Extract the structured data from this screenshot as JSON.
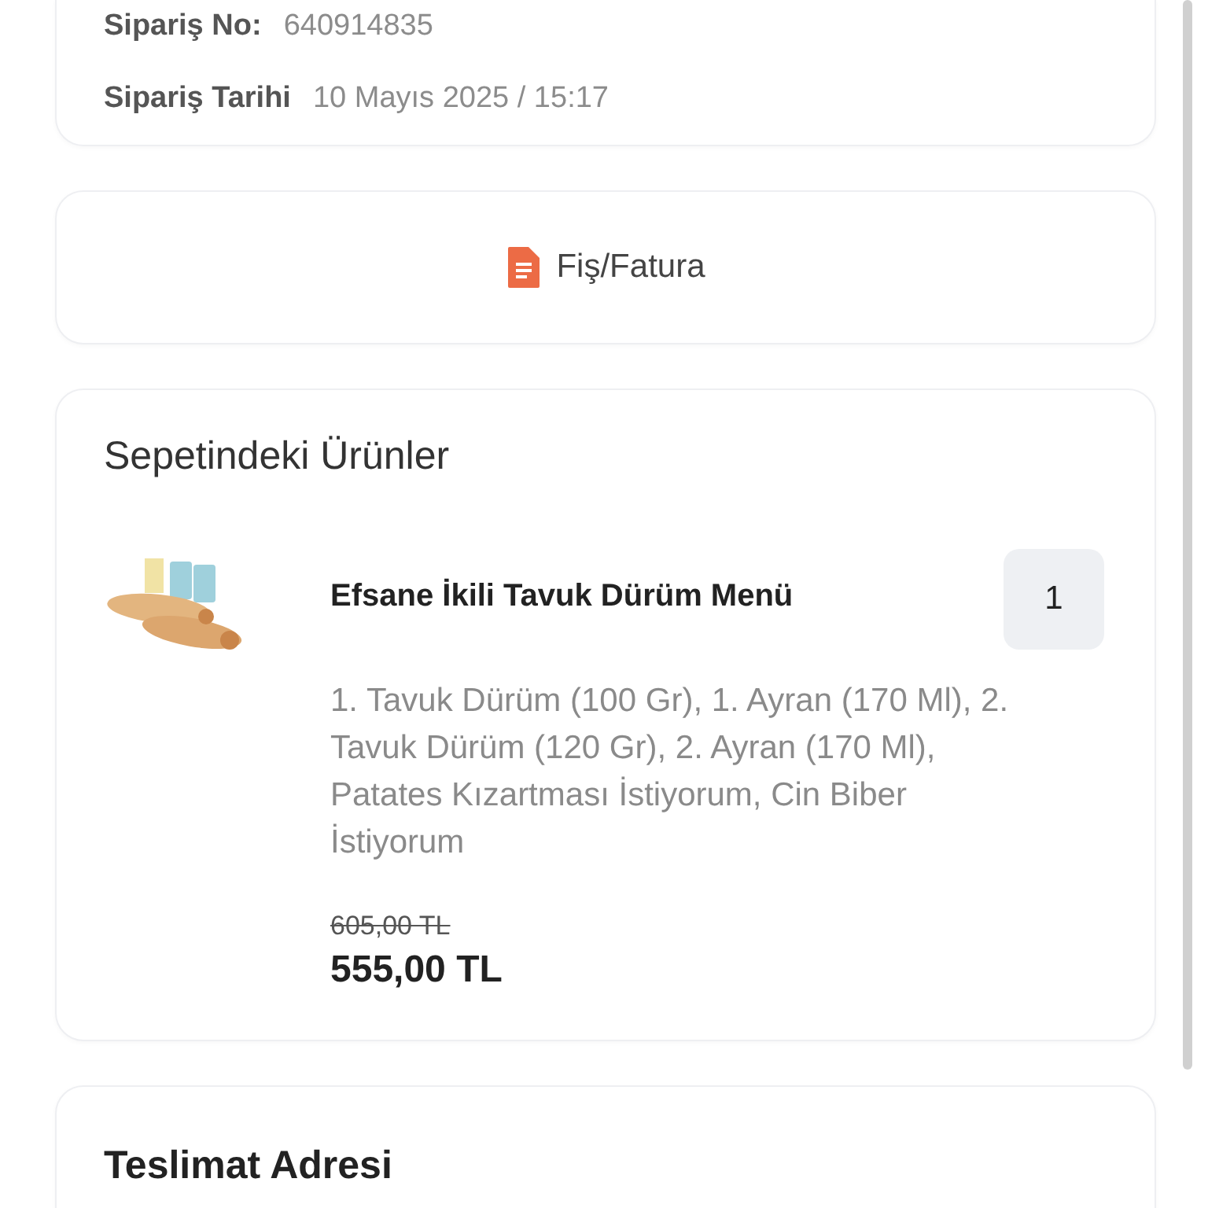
{
  "order_info": {
    "rows": [
      {
        "label": "Sipariş No:",
        "value": "640914835"
      },
      {
        "label": "Sipariş Tarihi",
        "value": "10 Mayıs 2025 / 15:17"
      }
    ]
  },
  "receipt_button": {
    "label": "Fiş/Fatura"
  },
  "basket": {
    "title": "Sepetindeki Ürünler",
    "items": [
      {
        "name": "Efsane İkili Tavuk Dürüm Menü",
        "quantity": "1",
        "description": "1. Tavuk Dürüm (100 Gr), 1. Ayran (170 Ml), 2. Tavuk Dürüm (120 Gr), 2. Ayran (170 Ml), Patates Kızartması İstiyorum, Cin Biber İstiyorum",
        "old_price": "605,00 TL",
        "price": "555,00 TL"
      }
    ]
  },
  "delivery": {
    "title": "Teslimat Adresi"
  }
}
